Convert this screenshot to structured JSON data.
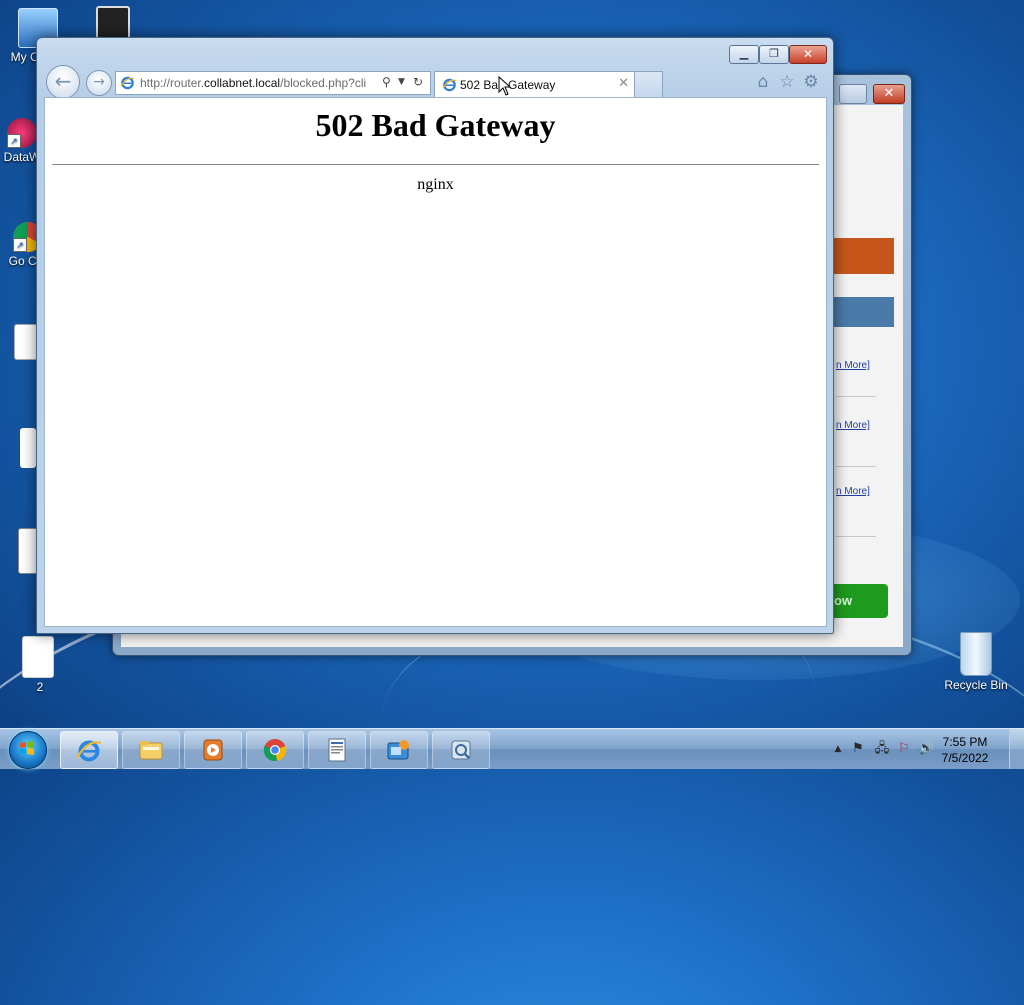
{
  "desktop": {
    "icons": [
      {
        "label": "My Co"
      },
      {
        "label": "DataW"
      },
      {
        "label": "Go Chr"
      },
      {
        "label": "2"
      },
      {
        "label": "Recycle Bin"
      }
    ]
  },
  "background_window": {
    "links": [
      "n More]",
      "n More]",
      "n More]"
    ],
    "button_text": "ow",
    "colors": {
      "orange": "#c7561d",
      "blue": "#4a7aa8",
      "green": "#1e9a1e"
    }
  },
  "browser": {
    "address": {
      "prefix": "http://router.",
      "domain": "collabnet.local",
      "path": "/blocked.php?cli"
    },
    "tab": {
      "title": "502 Bad Gateway"
    },
    "page": {
      "heading": "502 Bad Gateway",
      "server": "nginx"
    },
    "toolbar_icons": [
      "home-icon",
      "favorites-star-icon",
      "tools-gear-icon"
    ]
  },
  "taskbar": {
    "pinned": [
      {
        "name": "Internet Explorer",
        "icon": "ie-icon",
        "active": true
      },
      {
        "name": "Windows Explorer",
        "icon": "folder-icon"
      },
      {
        "name": "Media Player",
        "icon": "media-player-icon"
      },
      {
        "name": "Google Chrome",
        "icon": "chrome-icon"
      },
      {
        "name": "Document viewer",
        "icon": "document-icon"
      },
      {
        "name": "Network app",
        "icon": "network-app-icon"
      },
      {
        "name": "Tools app",
        "icon": "tools-app-icon"
      }
    ],
    "clock": {
      "time": "7:55 PM",
      "date": "7/5/2022"
    }
  }
}
